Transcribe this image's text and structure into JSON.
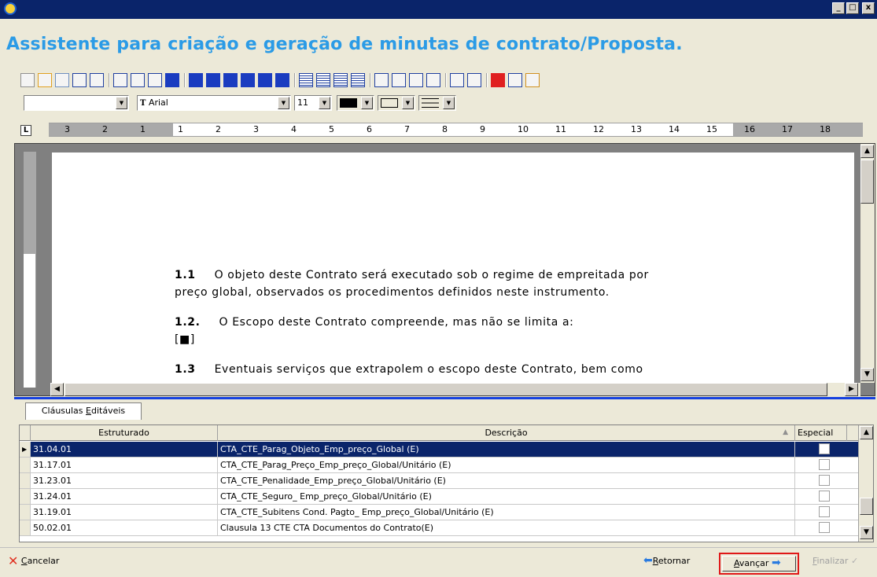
{
  "window": {
    "title": "",
    "controls": {
      "minimize": "_",
      "maximize": "□",
      "close": "x"
    }
  },
  "heading": "Assistente para criação e geração de minutas de contrato/Proposta.",
  "toolbar": {
    "row1_icons": [
      "new-icon",
      "open-icon",
      "save-icon",
      "print-icon",
      "print-preview-icon",
      "cut-icon",
      "copy-icon",
      "paste-icon",
      "undo-icon",
      "bold-icon",
      "italic-icon",
      "underline-icon",
      "strikethrough-icon",
      "superscript-icon",
      "subscript-icon",
      "align-left-icon",
      "align-center-icon",
      "align-right-icon",
      "justify-icon",
      "bullets-icon",
      "numbering-icon",
      "indent-decrease-icon",
      "indent-increase-icon",
      "table-insert-icon",
      "table-icon",
      "image-icon",
      "wizard-icon",
      "field-icon"
    ],
    "style_value": "",
    "font_value": "Arial",
    "font_size": "11"
  },
  "ruler": {
    "marks": [
      "3",
      "2",
      "1",
      "1",
      "2",
      "3",
      "4",
      "5",
      "6",
      "7",
      "8",
      "9",
      "10",
      "11",
      "12",
      "13",
      "14",
      "15",
      "16",
      "17",
      "18"
    ]
  },
  "document": {
    "paragraphs": [
      {
        "num": "1.1",
        "text": "O objeto deste Contrato será executado sob o regime de empreitada por"
      },
      {
        "num": "",
        "text": "preço global, observados os procedimentos definidos neste instrumento."
      },
      {
        "num": "1.2.",
        "text": "O Escopo deste Contrato compreende, mas não se limita a:"
      },
      {
        "num": "",
        "text": "[■]"
      },
      {
        "num": "1.3",
        "text": "Eventuais serviços que extrapolem o escopo deste Contrato, bem como"
      }
    ]
  },
  "tab": {
    "label_pre": "Cláusulas ",
    "label_underlined": "E",
    "label_post": "ditáveis"
  },
  "grid": {
    "columns": [
      "Estruturado",
      "Descrição",
      "Especial"
    ],
    "rows": [
      {
        "estruturado": "31.04.01",
        "descricao": "CTA_CTE_Parag_Objeto_Emp_preço_Global (E)",
        "selected": true
      },
      {
        "estruturado": "31.17.01",
        "descricao": "CTA_CTE_Parag_Preço_Emp_preço_Global/Unitário (E)",
        "selected": false
      },
      {
        "estruturado": "31.23.01",
        "descricao": "CTA_CTE_Penalidade_Emp_preço_Global/Unitário (E)",
        "selected": false
      },
      {
        "estruturado": "31.24.01",
        "descricao": "CTA_CTE_Seguro_ Emp_preço_Global/Unitário (E)",
        "selected": false
      },
      {
        "estruturado": "31.19.01",
        "descricao": "CTA_CTE_Subitens Cond. Pagto_ Emp_preço_Global/Unitário (E)",
        "selected": false
      },
      {
        "estruturado": "50.02.01",
        "descricao": "Clausula 13  CTE  CTA  Documentos do Contrato(E)",
        "selected": false
      }
    ]
  },
  "footer": {
    "cancel": {
      "u": "C",
      "rest": "ancelar"
    },
    "back": {
      "u": "R",
      "rest": "etornar"
    },
    "next": {
      "u": "A",
      "rest": "vançar"
    },
    "finish": {
      "u": "F",
      "rest": "inalizar"
    }
  },
  "colors": {
    "accent": "#2b9be6",
    "titlebar": "#0a246a",
    "selection": "#0a246a",
    "highlight_box": "#e01818"
  }
}
